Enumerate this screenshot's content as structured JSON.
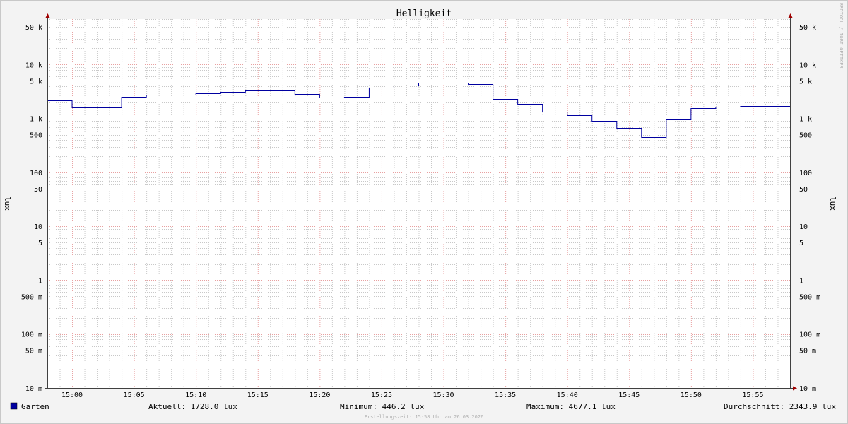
{
  "chart_data": {
    "type": "line",
    "title": "Helligkeit",
    "ylabel": "lux",
    "y_scale": "log",
    "ylim": [
      0.01,
      70000
    ],
    "xlim": [
      "14:58",
      "15:58"
    ],
    "grid": true,
    "y_tick_labels": [
      {
        "value": 50000,
        "label": "50 k"
      },
      {
        "value": 10000,
        "label": "10 k"
      },
      {
        "value": 5000,
        "label": "5 k"
      },
      {
        "value": 1000,
        "label": "1 k"
      },
      {
        "value": 500,
        "label": "500"
      },
      {
        "value": 100,
        "label": "100"
      },
      {
        "value": 50,
        "label": "50"
      },
      {
        "value": 10,
        "label": "10"
      },
      {
        "value": 5,
        "label": "5"
      },
      {
        "value": 1,
        "label": "1"
      },
      {
        "value": 0.5,
        "label": "500 m"
      },
      {
        "value": 0.1,
        "label": "100 m"
      },
      {
        "value": 0.05,
        "label": "50 m"
      },
      {
        "value": 0.01,
        "label": "10 m"
      }
    ],
    "x_tick_labels": [
      "15:00",
      "15:05",
      "15:10",
      "15:15",
      "15:20",
      "15:25",
      "15:30",
      "15:35",
      "15:40",
      "15:45",
      "15:50",
      "15:55"
    ],
    "series": [
      {
        "name": "Garten",
        "color": "#0000a0",
        "step": true,
        "x": [
          "14:58",
          "15:00",
          "15:02",
          "15:04",
          "15:06",
          "15:08",
          "15:10",
          "15:12",
          "15:14",
          "15:16",
          "15:18",
          "15:20",
          "15:22",
          "15:24",
          "15:26",
          "15:28",
          "15:30",
          "15:32",
          "15:34",
          "15:36",
          "15:38",
          "15:40",
          "15:42",
          "15:44",
          "15:46",
          "15:48",
          "15:50",
          "15:52",
          "15:54",
          "15:56"
        ],
        "values": [
          2150,
          1600,
          1600,
          2500,
          2750,
          2750,
          2900,
          3100,
          3350,
          3350,
          2850,
          2450,
          2550,
          3700,
          4100,
          4677.1,
          4677.1,
          4300,
          2300,
          1850,
          1350,
          1150,
          900,
          660,
          446.2,
          950,
          1550,
          1650,
          1728,
          1728
        ]
      }
    ],
    "legend": "bottom-left"
  },
  "stats": {
    "current": "Aktuell: 1728.0 lux",
    "minimum": "Minimum: 446.2 lux",
    "maximum": "Maximum: 4677.1 lux",
    "average": "Durchschnitt: 2343.9 lux"
  },
  "watermark": "RRDTOOL / TOBI OETIKER",
  "footer": "Erstellungszeit: 15:58 Uhr am 26.03.2026",
  "colors": {
    "background": "#f3f3f3",
    "canvas": "#ffffff",
    "major_grid": "#e8a0a0",
    "minor_grid": "#c8c8c8",
    "axis": "#404040",
    "arrow": "#a00000",
    "series": "#0000a0"
  }
}
